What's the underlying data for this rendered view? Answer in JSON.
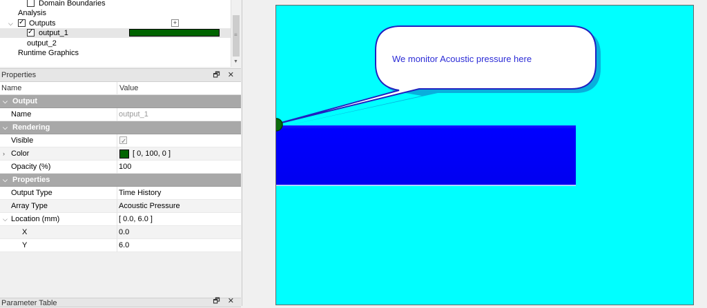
{
  "tree": {
    "items": [
      {
        "label": "Domain Boundaries",
        "checked": false
      },
      {
        "label": "Analysis"
      },
      {
        "label": "Outputs",
        "checked": true,
        "add_label": "+"
      },
      {
        "label": "output_1",
        "checked": true,
        "color": "#006400"
      },
      {
        "label": "output_2"
      },
      {
        "label": "Runtime Graphics"
      }
    ]
  },
  "properties_panel": {
    "title": "Properties",
    "header_buttons": "🗗 ✕",
    "columns": {
      "name": "Name",
      "value": "Value"
    },
    "groups": {
      "output": "Output",
      "rendering": "Rendering",
      "properties": "Properties"
    },
    "rows": {
      "name": {
        "label": "Name",
        "value": "output_1"
      },
      "visible": {
        "label": "Visible",
        "checked": true
      },
      "color": {
        "label": "Color",
        "value": "[ 0, 100, 0 ]",
        "swatch": "#006400"
      },
      "opacity": {
        "label": "Opacity (%)",
        "value": "100"
      },
      "output_type": {
        "label": "Output Type",
        "value": "Time History"
      },
      "array_type": {
        "label": "Array Type",
        "value": "Acoustic Pressure"
      },
      "location": {
        "label": "Location (mm)",
        "value": "[ 0.0, 6.0 ]"
      },
      "x": {
        "label": "X",
        "value": "0.0"
      },
      "y": {
        "label": "Y",
        "value": "6.0"
      }
    }
  },
  "parameter_panel": {
    "title": "Parameter Table",
    "header_buttons": "🗗 ✕"
  },
  "viewport": {
    "callout_text": "We monitor Acoustic pressure here",
    "colors": {
      "background": "#00ffff",
      "block": "#0000ff",
      "probe": "#0b6b0b",
      "callout_border": "#2020c0",
      "callout_text": "#2b2bd6"
    }
  }
}
